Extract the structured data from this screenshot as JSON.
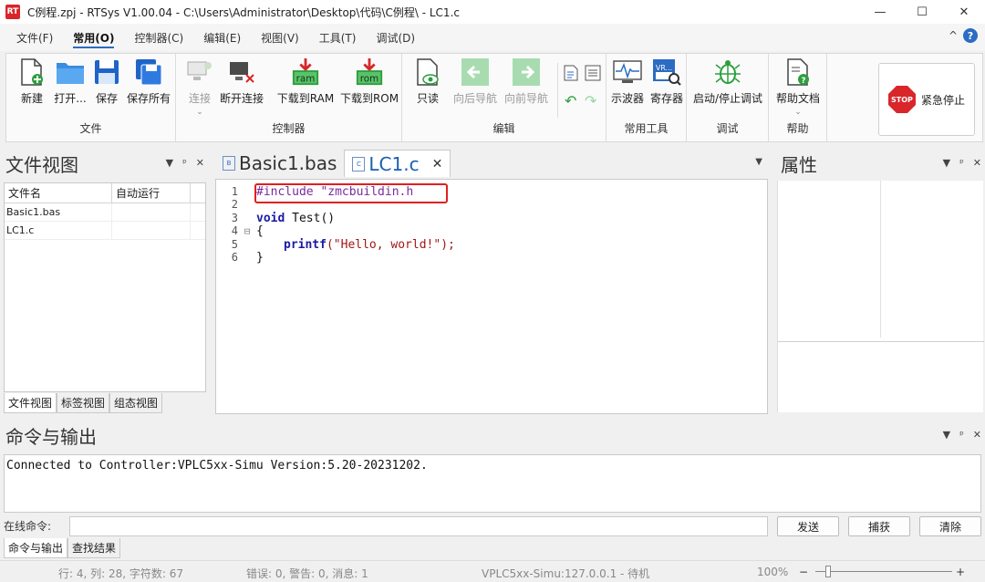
{
  "window": {
    "app_icon": "RT",
    "title": "C例程.zpj - RTSys V1.00.04 - C:\\Users\\Administrator\\Desktop\\代码\\C例程\\ - LC1.c",
    "minimize": "—",
    "maximize": "☐",
    "close": "✕"
  },
  "menu": {
    "tabs": [
      {
        "label": "文件(F)"
      },
      {
        "label": "常用(O)"
      },
      {
        "label": "控制器(C)"
      },
      {
        "label": "编辑(E)"
      },
      {
        "label": "视图(V)"
      },
      {
        "label": "工具(T)"
      },
      {
        "label": "调试(D)"
      }
    ],
    "collapse_glyph": "^",
    "help_glyph": "?"
  },
  "ribbon": {
    "file_group": {
      "label": "文件",
      "new": "新建",
      "open": "打开...",
      "save": "保存",
      "save_all": "保存所有"
    },
    "controller_group": {
      "label": "控制器",
      "connect": "连接",
      "disconnect": "断开连接",
      "download_ram": "下载到RAM",
      "download_rom": "下载到ROM",
      "ram_text": "ram",
      "rom_text": "rom"
    },
    "edit_group": {
      "label": "编辑",
      "readonly": "只读",
      "nav_back": "向后导航",
      "nav_forward": "向前导航"
    },
    "tools_group": {
      "label": "常用工具",
      "oscilloscope": "示波器",
      "register": "寄存器",
      "vr_text": "VR..."
    },
    "debug_group": {
      "label": "调试",
      "start_stop_debug": "启动/停止调试"
    },
    "help_group": {
      "label": "帮助",
      "help_doc": "帮助文档"
    },
    "emergency_stop": "紧急停止",
    "stop_text": "STOP"
  },
  "file_view": {
    "title": "文件视图",
    "columns": [
      "文件名",
      "自动运行"
    ],
    "rows": [
      {
        "name": "Basic1.bas",
        "auto": ""
      },
      {
        "name": "LC1.c",
        "auto": ""
      }
    ],
    "bottom_tabs": [
      "文件视图",
      "标签视图",
      "组态视图"
    ]
  },
  "editor": {
    "tabs": [
      {
        "label": "Basic1.bas",
        "icon": "B"
      },
      {
        "label": "LC1.c",
        "icon": "C"
      }
    ],
    "lines": [
      {
        "num": "1",
        "text": "#include \"zmcbuildin.h"
      },
      {
        "num": "2",
        "text": ""
      },
      {
        "num": "3",
        "kw": "void",
        "text": " Test()"
      },
      {
        "num": "4",
        "text": "{"
      },
      {
        "num": "5",
        "fn": "printf",
        "str": "(\"Hello, world!\");"
      },
      {
        "num": "6",
        "text": "}"
      }
    ]
  },
  "properties": {
    "title": "属性"
  },
  "command": {
    "title": "命令与输出",
    "output": "Connected to Controller:VPLC5xx-Simu Version:5.20-20231202.",
    "online_label": "在线命令:",
    "send": "发送",
    "capture": "捕获",
    "clear": "清除",
    "bottom_tabs": [
      "命令与输出",
      "查找结果"
    ]
  },
  "status": {
    "position": "行: 4, 列: 28, 字符数: 67",
    "messages": "错误: 0, 警告: 0, 消息: 1",
    "connection": "VPLC5xx-Simu:127.0.0.1 - 待机",
    "zoom": "100%",
    "zoom_minus": "−",
    "zoom_plus": "+"
  }
}
